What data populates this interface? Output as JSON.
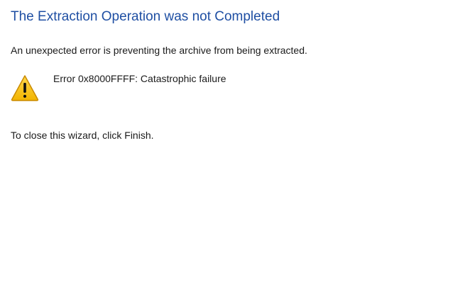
{
  "dialog": {
    "title": "The Extraction Operation was not Completed",
    "message": "An unexpected error is preventing the archive from being extracted.",
    "error": {
      "icon": "warning-icon",
      "text": "Error 0x8000FFFF: Catastrophic failure"
    },
    "close_hint": "To close this wizard, click Finish."
  },
  "colors": {
    "title": "#1f4fa3",
    "warning_fill": "#f7c21b",
    "warning_stroke": "#c98a00",
    "text": "#1a1a1a",
    "background": "#ffffff"
  }
}
